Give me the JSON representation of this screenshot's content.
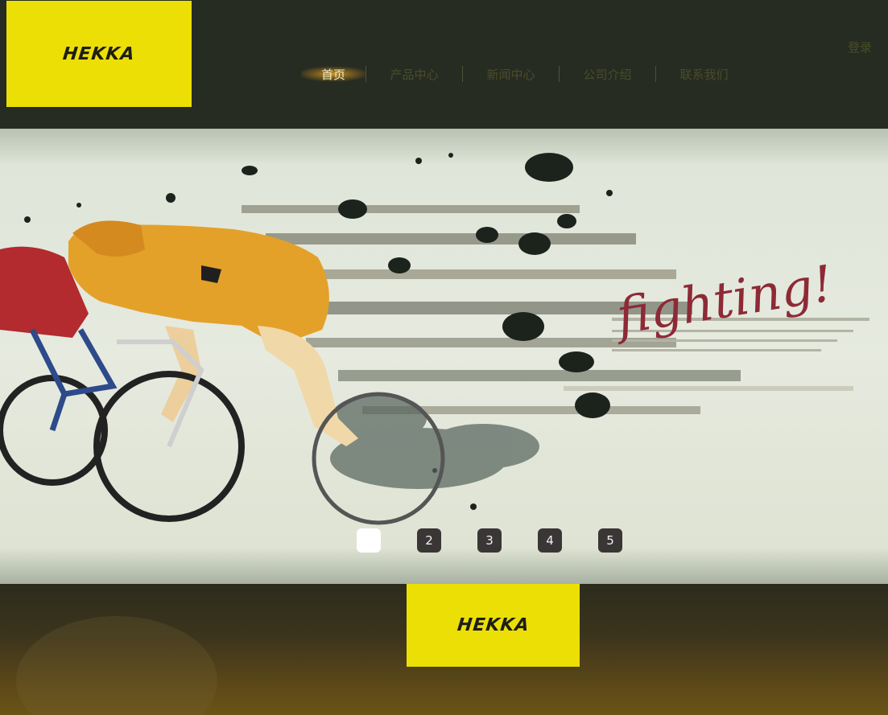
{
  "header": {
    "logo": "HEKKA",
    "login_label": "登录"
  },
  "nav": {
    "items": [
      {
        "label": "首页",
        "active": true
      },
      {
        "label": "产品中心",
        "active": false
      },
      {
        "label": "新闻中心",
        "active": false
      },
      {
        "label": "公司介绍",
        "active": false
      },
      {
        "label": "联系我们",
        "active": false
      }
    ]
  },
  "banner": {
    "headline": "fighting!",
    "slides": [
      "",
      "2",
      "3",
      "4",
      "5"
    ],
    "active_slide": 1
  },
  "footer": {
    "logo": "HEKKA"
  },
  "colors": {
    "header_bg": "#272c22",
    "logo_yellow": "#ecdf06",
    "nav_active": "#d6a028",
    "footer_gold": "#6a5416"
  }
}
